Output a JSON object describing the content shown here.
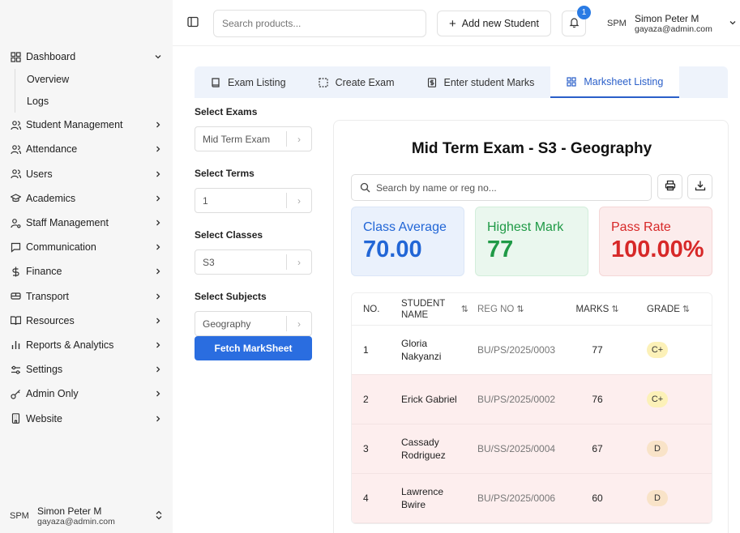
{
  "sidebar": {
    "items": [
      {
        "label": "Dashboard",
        "icon": "grid-icon",
        "expanded": true,
        "sub": [
          {
            "label": "Overview"
          },
          {
            "label": "Logs"
          }
        ]
      },
      {
        "label": "Student Management",
        "icon": "users-icon"
      },
      {
        "label": "Attendance",
        "icon": "users-icon"
      },
      {
        "label": "Users",
        "icon": "users-icon"
      },
      {
        "label": "Academics",
        "icon": "graduation-cap-icon"
      },
      {
        "label": "Staff Management",
        "icon": "user-cog-icon"
      },
      {
        "label": "Communication",
        "icon": "message-icon"
      },
      {
        "label": "Finance",
        "icon": "dollar-icon"
      },
      {
        "label": "Transport",
        "icon": "bus-icon"
      },
      {
        "label": "Resources",
        "icon": "book-open-icon"
      },
      {
        "label": "Reports & Analytics",
        "icon": "bar-chart-icon"
      },
      {
        "label": "Settings",
        "icon": "settings-icon"
      },
      {
        "label": "Admin Only",
        "icon": "key-icon"
      },
      {
        "label": "Website",
        "icon": "building-icon"
      }
    ],
    "footer": {
      "avatar": "SPM",
      "name": "Simon Peter M",
      "email": "gayaza@admin.com"
    }
  },
  "header": {
    "search_placeholder": "Search products...",
    "add_button": "Add new Student",
    "notifications_count": "1",
    "user": {
      "avatar": "SPM",
      "name": "Simon Peter M",
      "email": "gayaza@admin.com"
    }
  },
  "tabs": [
    {
      "label": "Exam Listing",
      "icon": "book-icon"
    },
    {
      "label": "Create Exam",
      "icon": "dashed-square-icon"
    },
    {
      "label": "Enter student Marks",
      "icon": "dollar-file-icon"
    },
    {
      "label": "Marksheet Listing",
      "icon": "grid-icon",
      "active": true
    }
  ],
  "filters": [
    {
      "label": "Select Exams",
      "value": "Mid Term Exam"
    },
    {
      "label": "Select Terms",
      "value": "1"
    },
    {
      "label": "Select Classes",
      "value": "S3"
    },
    {
      "label": "Select Subjects",
      "value": "Geography"
    }
  ],
  "fetch_button": "Fetch MarkSheet",
  "report": {
    "title": "Mid Term Exam - S3 - Geography",
    "search_placeholder": "Search by name or reg no...",
    "stats": [
      {
        "title": "Class Average",
        "value": "70.00"
      },
      {
        "title": "Highest Mark",
        "value": "77"
      },
      {
        "title": "Pass Rate",
        "value": "100.00%"
      }
    ],
    "columns": [
      "NO.",
      "STUDENT NAME",
      "REG NO",
      "MARKS",
      "GRADE"
    ],
    "rows": [
      {
        "no": "1",
        "name": "Gloria Nakyanzi",
        "reg": "BU/PS/2025/0003",
        "marks": "77",
        "grade": "C+"
      },
      {
        "no": "2",
        "name": "Erick Gabriel",
        "reg": "BU/PS/2025/0002",
        "marks": "76",
        "grade": "C+"
      },
      {
        "no": "3",
        "name": "Cassady Rodriguez",
        "reg": "BU/SS/2025/0004",
        "marks": "67",
        "grade": "D"
      },
      {
        "no": "4",
        "name": "Lawrence Bwire",
        "reg": "BU/PS/2025/0006",
        "marks": "60",
        "grade": "D"
      }
    ]
  },
  "colors": {
    "accent": "#2a6de0",
    "tab_active": "#2a5fc9",
    "avg": "#2266d6",
    "high": "#1f9a46",
    "pass": "#d72828"
  }
}
